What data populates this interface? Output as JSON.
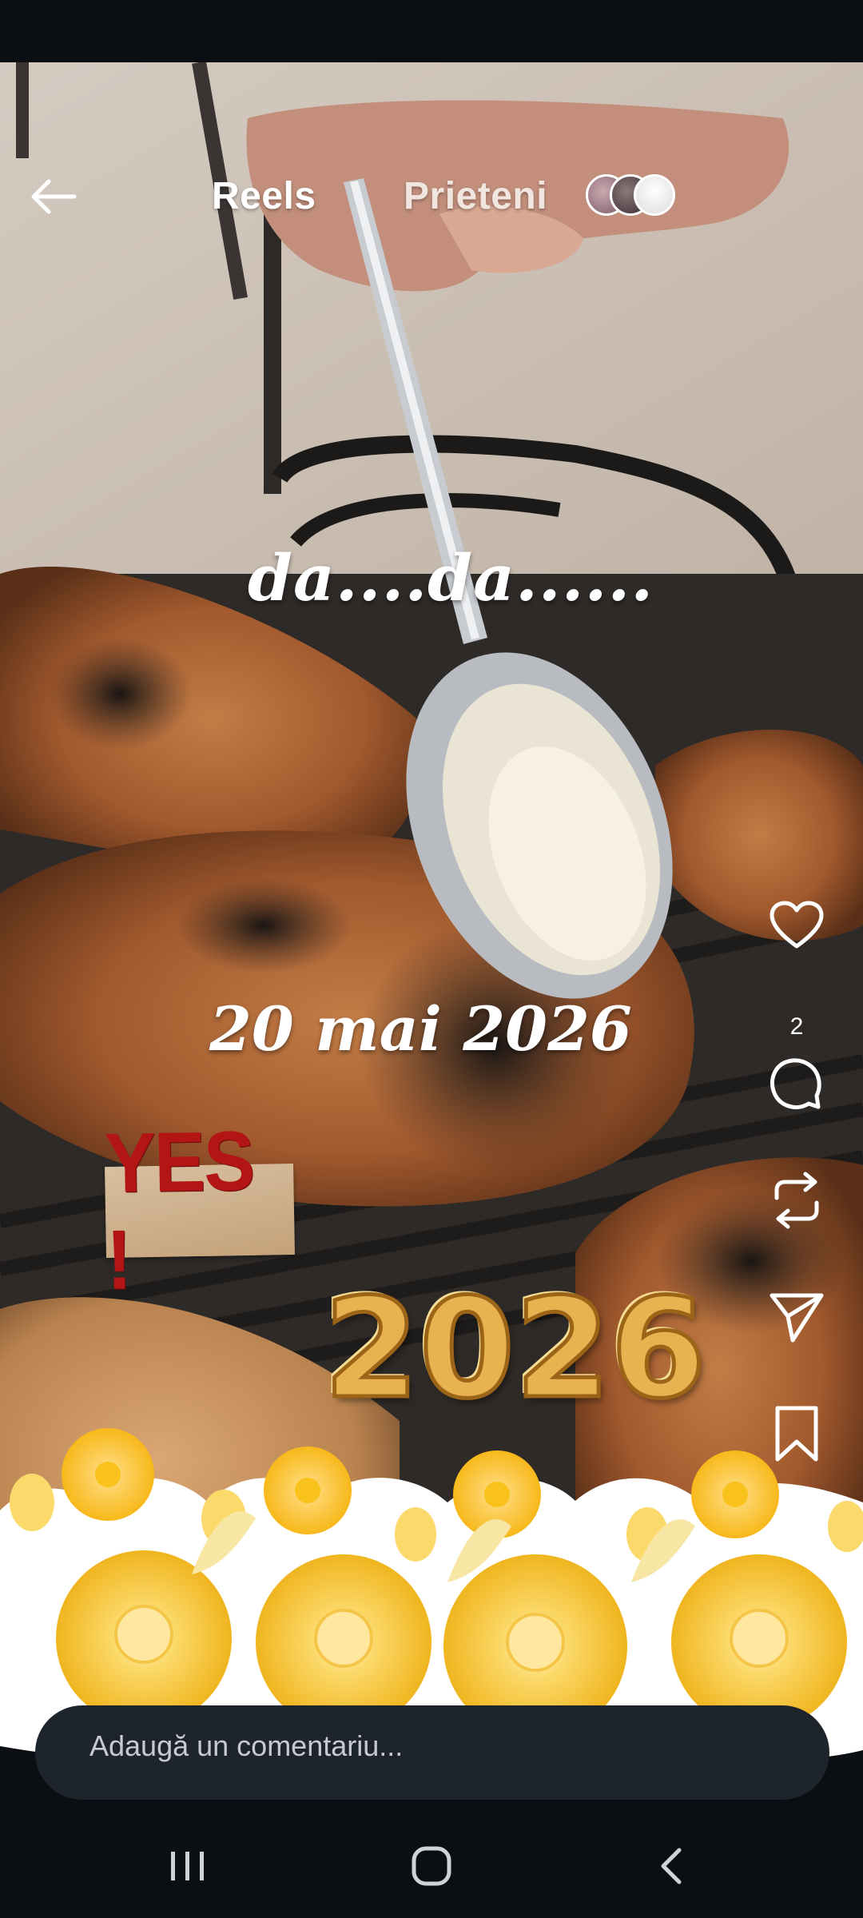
{
  "header": {
    "back_icon": "arrow-left-icon",
    "tabs": [
      {
        "label": "Reels",
        "active": true
      },
      {
        "label": "Prieteni",
        "active": false
      }
    ]
  },
  "video": {
    "overlays": {
      "top_text": "da....da......",
      "date_text": "20 mai 2026",
      "sticker_text": "YES !",
      "balloon_text": "2026"
    }
  },
  "actions": {
    "like_icon": "heart-icon",
    "like_count": "2",
    "comment_icon": "comment-icon",
    "repost_icon": "repost-icon",
    "share_icon": "send-icon",
    "save_icon": "bookmark-icon"
  },
  "comment": {
    "placeholder": "Adaugă un comentariu..."
  },
  "nav": {
    "recents_icon": "recent-apps-icon",
    "home_icon": "home-icon",
    "back_icon": "back-chevron-icon"
  },
  "colors": {
    "background": "#0b0f14",
    "text": "#ffffff",
    "comment_bar": "#1e242b",
    "sticker_red": "#b31515",
    "balloon_gold": "#e7b24f",
    "flower_yellow": "#f6c83a"
  }
}
